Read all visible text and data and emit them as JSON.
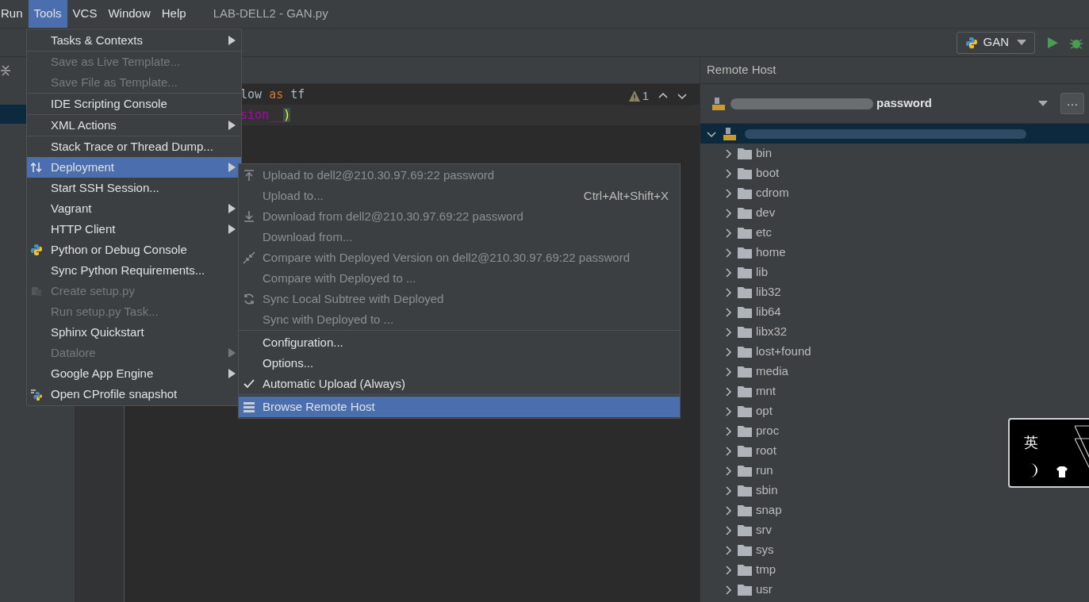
{
  "menubar": [
    {
      "label": "Run",
      "selected": false
    },
    {
      "label": "Tools",
      "selected": true
    },
    {
      "label": "VCS",
      "selected": false
    },
    {
      "label": "Window",
      "selected": false
    },
    {
      "label": "Help",
      "selected": false
    }
  ],
  "window_title": "LAB-DELL2 - GAN.py",
  "run_config": {
    "label": "GAN"
  },
  "editor": {
    "lines": [
      [
        {
          "text": "low ",
          "kind": "plain"
        },
        {
          "text": "as",
          "kind": "keyword"
        },
        {
          "text": " tf",
          "kind": "plain"
        }
      ],
      [
        {
          "text": "sion__",
          "kind": "dunder"
        },
        {
          "text": ")",
          "kind": "paren"
        }
      ]
    ],
    "warnings": "1"
  },
  "tools_menu": [
    [
      {
        "label": "Tasks & Contexts",
        "submenu": true,
        "disabled": false,
        "selected": false
      }
    ],
    [
      {
        "label": "Save as Live Template...",
        "submenu": false,
        "disabled": true,
        "selected": false
      },
      {
        "label": "Save File as Template...",
        "submenu": false,
        "disabled": true,
        "selected": false
      }
    ],
    [
      {
        "label": "IDE Scripting Console",
        "submenu": false,
        "disabled": false,
        "selected": false
      }
    ],
    [
      {
        "label": "XML Actions",
        "submenu": true,
        "disabled": false,
        "selected": false
      }
    ],
    [
      {
        "label": "Stack Trace or Thread Dump...",
        "submenu": false,
        "disabled": false,
        "selected": false
      },
      {
        "label": "Deployment",
        "submenu": true,
        "disabled": false,
        "selected": true,
        "kind": "deploy"
      },
      {
        "label": "Start SSH Session...",
        "submenu": false,
        "disabled": false,
        "selected": false
      },
      {
        "label": "Vagrant",
        "submenu": true,
        "disabled": false,
        "selected": false
      },
      {
        "label": "HTTP Client",
        "submenu": true,
        "disabled": false,
        "selected": false
      },
      {
        "label": "Python or Debug Console",
        "submenu": false,
        "disabled": false,
        "selected": false,
        "kind": "python"
      },
      {
        "label": "Sync Python Requirements...",
        "submenu": false,
        "disabled": false,
        "selected": false
      },
      {
        "label": "Create setup.py",
        "submenu": false,
        "disabled": true,
        "selected": false,
        "kind": "setup"
      },
      {
        "label": "Run setup.py Task...",
        "submenu": false,
        "disabled": true,
        "selected": false
      },
      {
        "label": "Sphinx Quickstart",
        "submenu": false,
        "disabled": false,
        "selected": false
      },
      {
        "label": "Datalore",
        "submenu": true,
        "disabled": true,
        "selected": false
      },
      {
        "label": "Google App Engine",
        "submenu": true,
        "disabled": false,
        "selected": false
      },
      {
        "label": "Open CProfile snapshot",
        "submenu": false,
        "disabled": false,
        "selected": false,
        "kind": "cprofile"
      }
    ]
  ],
  "deployment_menu": [
    [
      {
        "label": "Upload to dell2@210.30.97.69:22 password",
        "disabled": true,
        "selected": false,
        "kind": "upload"
      },
      {
        "label": "Upload to...",
        "disabled": true,
        "selected": false,
        "shortcut": "Ctrl+Alt+Shift+X"
      },
      {
        "label": "Download from dell2@210.30.97.69:22 password",
        "disabled": true,
        "selected": false,
        "kind": "download"
      },
      {
        "label": "Download from...",
        "disabled": true,
        "selected": false
      },
      {
        "label": "Compare with Deployed Version on dell2@210.30.97.69:22 password",
        "disabled": true,
        "selected": false,
        "kind": "compare"
      },
      {
        "label": "Compare with Deployed to ...",
        "disabled": true,
        "selected": false
      },
      {
        "label": "Sync Local Subtree with Deployed",
        "disabled": true,
        "selected": false,
        "kind": "sync"
      },
      {
        "label": "Sync with Deployed to ...",
        "disabled": true,
        "selected": false
      }
    ],
    [
      {
        "label": "Configuration...",
        "disabled": false,
        "selected": false
      },
      {
        "label": "Options...",
        "disabled": false,
        "selected": false
      },
      {
        "label": "Automatic Upload (Always)",
        "disabled": false,
        "selected": false,
        "checked": true
      }
    ],
    [
      {
        "label": "Browse Remote Host",
        "disabled": false,
        "selected": true,
        "kind": "browse"
      }
    ]
  ],
  "remote_host": {
    "title": "Remote Host",
    "server_visible_text": "password",
    "more_button": "…",
    "folders": [
      {
        "name": "bin"
      },
      {
        "name": "boot"
      },
      {
        "name": "cdrom"
      },
      {
        "name": "dev"
      },
      {
        "name": "etc"
      },
      {
        "name": "home"
      },
      {
        "name": "lib"
      },
      {
        "name": "lib32"
      },
      {
        "name": "lib64"
      },
      {
        "name": "libx32"
      },
      {
        "name": "lost+found"
      },
      {
        "name": "media"
      },
      {
        "name": "mnt"
      },
      {
        "name": "opt"
      },
      {
        "name": "proc"
      },
      {
        "name": "root"
      },
      {
        "name": "run"
      },
      {
        "name": "sbin"
      },
      {
        "name": "snap"
      },
      {
        "name": "srv"
      },
      {
        "name": "sys"
      },
      {
        "name": "tmp"
      },
      {
        "name": "usr"
      }
    ]
  },
  "ime_indicator": {
    "mode": "英"
  }
}
